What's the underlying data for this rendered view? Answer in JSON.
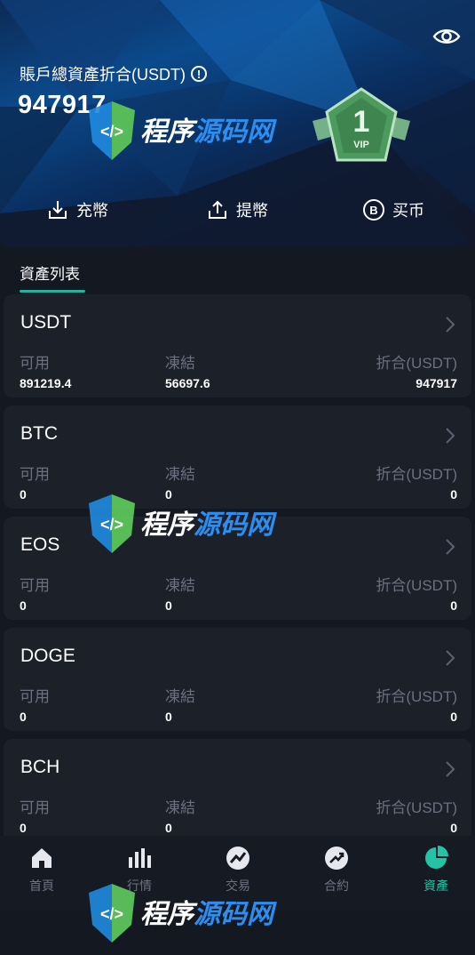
{
  "header": {
    "asset_label": "賬戶總資產折合(USDT)",
    "asset_value": "947917",
    "vip_level": "1",
    "vip_text": "VIP",
    "actions": [
      {
        "label": "充幣",
        "icon": "download-icon"
      },
      {
        "label": "提幣",
        "icon": "upload-icon"
      },
      {
        "label": "买币",
        "icon": "bitcoin-icon"
      }
    ]
  },
  "list": {
    "title": "資產列表",
    "columns": [
      "可用",
      "凍結",
      "折合(USDT)"
    ],
    "assets": [
      {
        "coin": "USDT",
        "available": "891219.4",
        "frozen": "56697.6",
        "converted": "947917"
      },
      {
        "coin": "BTC",
        "available": "0",
        "frozen": "0",
        "converted": "0"
      },
      {
        "coin": "EOS",
        "available": "0",
        "frozen": "0",
        "converted": "0"
      },
      {
        "coin": "DOGE",
        "available": "0",
        "frozen": "0",
        "converted": "0"
      },
      {
        "coin": "BCH",
        "available": "0",
        "frozen": "0",
        "converted": "0"
      }
    ]
  },
  "nav": {
    "items": [
      {
        "label": "首頁",
        "icon": "home-icon"
      },
      {
        "label": "行情",
        "icon": "chart-bars-icon"
      },
      {
        "label": "交易",
        "icon": "trade-icon"
      },
      {
        "label": "合約",
        "icon": "contract-icon"
      },
      {
        "label": "資產",
        "icon": "pie-chart-icon"
      }
    ],
    "active_index": 4
  },
  "watermark": {
    "text": "程序源码网"
  },
  "colors": {
    "accent": "#23b39a",
    "card_bg": "#1c2029",
    "page_bg": "#141821"
  }
}
